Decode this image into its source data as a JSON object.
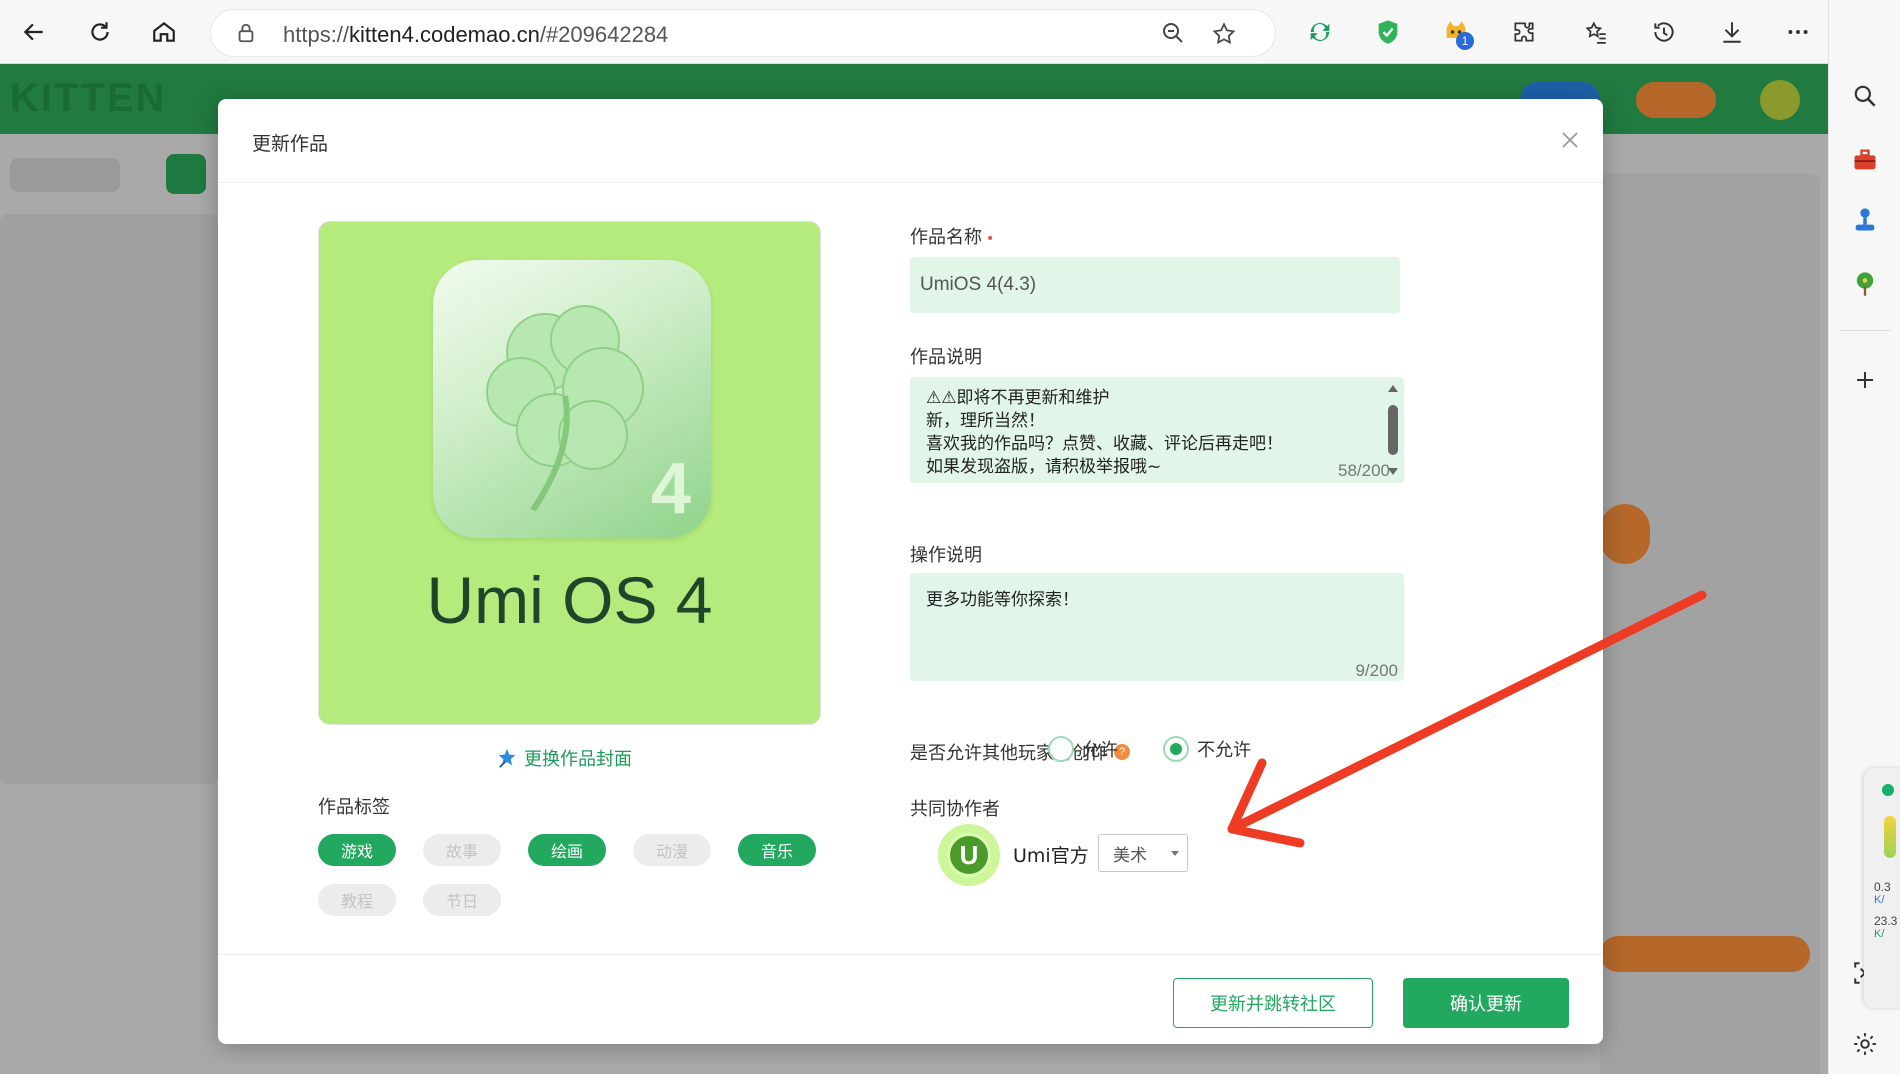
{
  "browser": {
    "url_prefix": "https://",
    "url_host": "kitten4.codemao.cn",
    "url_rest": "/#209642284",
    "extension_badge": "1"
  },
  "background": {
    "logo": "KITTEN"
  },
  "modal": {
    "title": "更新作品",
    "cover": {
      "app_number": "4",
      "title": "Umi OS 4",
      "change_label": "更换作品封面"
    },
    "tags_label": "作品标签",
    "tags": [
      {
        "label": "游戏",
        "selected": true
      },
      {
        "label": "故事",
        "selected": false
      },
      {
        "label": "绘画",
        "selected": true
      },
      {
        "label": "动漫",
        "selected": false
      },
      {
        "label": "音乐",
        "selected": true
      },
      {
        "label": "教程",
        "selected": false
      },
      {
        "label": "节日",
        "selected": false
      }
    ],
    "name_label": "作品名称",
    "name_required_mark": "•",
    "name_value": "UmiOS 4(4.3)",
    "desc_label": "作品说明",
    "desc_text": "⚠⚠即将不再更新和维护\n新，理所当然！\n喜欢我的作品吗？点赞、收藏、评论后再走吧！\n如果发现盗版，请积极举报哦~",
    "desc_count": "58/200",
    "ops_label": "操作说明",
    "ops_text": "更多功能等你探索！",
    "ops_count": "9/200",
    "remix_label": "是否允许其他玩家再创作",
    "remix_help": "?",
    "remix_options": [
      {
        "label": "允许",
        "checked": false
      },
      {
        "label": "不允许",
        "checked": true
      }
    ],
    "collab_label": "共同协作者",
    "collaborator": {
      "avatar_letter": "U",
      "name": "Umi官方",
      "role": "美术"
    },
    "btn_update_jump": "更新并跳转社区",
    "btn_confirm": "确认更新"
  },
  "float_widget": {
    "line1_value": "0.3",
    "line1_unit": "K/",
    "line2_value": "23.3",
    "line2_unit": "K/"
  },
  "colors": {
    "accent": "#22a85f",
    "input_bg": "#e1f5e8",
    "cover_bg": "#b5ea7d",
    "arrow": "#ee3b24"
  },
  "icons": [
    "back-icon",
    "refresh-icon",
    "home-icon",
    "lock-icon",
    "zoom-icon",
    "star-icon",
    "extension-icons",
    "favorites-icon",
    "history-icon",
    "download-icon",
    "more-icon",
    "sidebar-toggle-icon",
    "search-icon",
    "toolbox-icon",
    "joystick-icon",
    "tree-icon",
    "plus-icon",
    "settings-icon",
    "close-icon",
    "magic-wand-icon",
    "help-icon"
  ]
}
